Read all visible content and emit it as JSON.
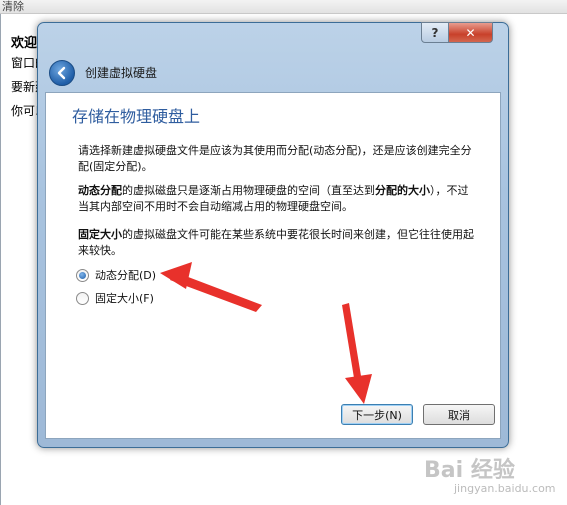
{
  "background": {
    "toolbar_text": "清除",
    "title": "欢迎使用虚拟电脑控制台!",
    "lines": [
      "窗口的",
      "要新建",
      "你可以"
    ]
  },
  "dialog": {
    "window_buttons": {
      "help": "?",
      "close": "✕"
    },
    "wizard_title": "创建虚拟硬盘",
    "page_title": "存储在物理硬盘上",
    "intro": "请选择新建虚拟硬盘文件是应该为其使用而分配(动态分配)，还是应该创建完全分配(固定分配)。",
    "dynamic_desc": {
      "bold1": "动态分配",
      "text1": "的虚拟磁盘只是逐渐占用物理硬盘的空间（直至达到",
      "bold2": "分配的大小",
      "text2": "），不过当其内部空间不用时不会自动缩减占用的物理硬盘空间。"
    },
    "fixed_desc": {
      "bold": "固定大小",
      "text": "的虚拟磁盘文件可能在某些系统中要花很长时间来创建，但它往往使用起来较快。"
    },
    "options": [
      {
        "label": "动态分配(D)",
        "selected": true
      },
      {
        "label": "固定大小(F)",
        "selected": false
      }
    ],
    "buttons": {
      "next": "下一步(N)",
      "cancel": "取消"
    }
  },
  "watermark": {
    "main": "Bai 经验",
    "sub": "jingyan.baidu.com"
  },
  "colors": {
    "accent": "#2f5d9f",
    "arrow": "#e8312b"
  }
}
